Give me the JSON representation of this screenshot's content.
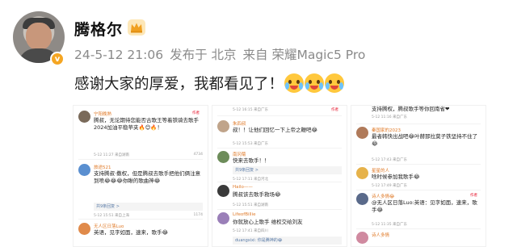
{
  "post": {
    "author": "腾格尔",
    "timestamp": "24-5-12 21:06",
    "published_from": "发布于 北京",
    "device": "来自 荣耀Magic5 Pro",
    "caption": "感谢大家的厚爱，我都看见了！"
  },
  "columns": [
    {
      "comments": [
        {
          "name": "宁阳晚熟",
          "text": "腾叔，无论期待您能否古歌王等着铁骑去歌手2024加油平稳苹夹🔥😊🔥！",
          "info": "5-12 11:27 来自湖南",
          "likes": "4734",
          "mark": "作者"
        },
        {
          "name": "旅途521",
          "text": "支持腾叔·撒权，但是腾叔去歌手把他们俩注意到喷😂😂😂你瞅的歌曲神😂",
          "info": "5-12 15:51 来自上海",
          "likes": "1174",
          "mark": "",
          "reply": "共9条回复 >"
        },
        {
          "name": "无人区日落Luo",
          "text": "英语，见字如面，速来，歌手😂",
          "info": "",
          "likes": "",
          "mark": ""
        }
      ]
    },
    {
      "comments": [
        {
          "name": "",
          "text": "",
          "info": "5-12 16:15 来自广东",
          "likes": "",
          "mark": "作者"
        },
        {
          "name": "朱四叔",
          "text": "叔！！让他们回忆一下上帝之鞭吧😂",
          "info": "5-12 15:53 来自广东",
          "likes": "",
          "mark": ""
        },
        {
          "name": "南冈菊",
          "text": "快来去歌手！！",
          "info": "5-12 17:11 来自河北",
          "likes": "",
          "mark": "",
          "reply": "共9条回复 >"
        },
        {
          "name": "Hailo——",
          "text": "腾叔该去歌手救场😂",
          "info": "5-12 15:51 来自湖南",
          "likes": "",
          "mark": ""
        },
        {
          "name": "LifeofBillie",
          "text": "你就放心上歌手 维权交给刘友",
          "info": "5-12 17:41 来自四川",
          "likes": "",
          "mark": "",
          "reply": "duangxixi: 你是腾神的😂"
        }
      ]
    },
    {
      "comments": [
        {
          "name": "",
          "text": "支持腾权，腾叔歌手等你回南省❤",
          "info": "5-12 11:16 来自广东",
          "likes": "",
          "mark": ""
        },
        {
          "name": "秦国家的2023",
          "text": "最者韩快出战吧😂叶赫那拉莫子铁坚持不住了😂",
          "info": "5-12 17:43 来自广东",
          "likes": "",
          "mark": ""
        },
        {
          "name": "星星的人",
          "text": "啥时候参加我歌手😂",
          "info": "5-12 17:49 来自广东",
          "likes": "",
          "mark": ""
        },
        {
          "name": "诗人多情😂",
          "text": "@无人区日落Luo:英语：见字如面，速来，歌手😂",
          "info": "5-12 11:35 来自广东",
          "likes": "",
          "mark": "作者"
        },
        {
          "name": "诗人多情",
          "text": "",
          "info": "",
          "likes": "",
          "mark": ""
        }
      ]
    }
  ],
  "colors": {
    "name_orange": "#e07b2a",
    "meta_gray": "#8a8a8a",
    "badge_gold": "#f5a623"
  }
}
